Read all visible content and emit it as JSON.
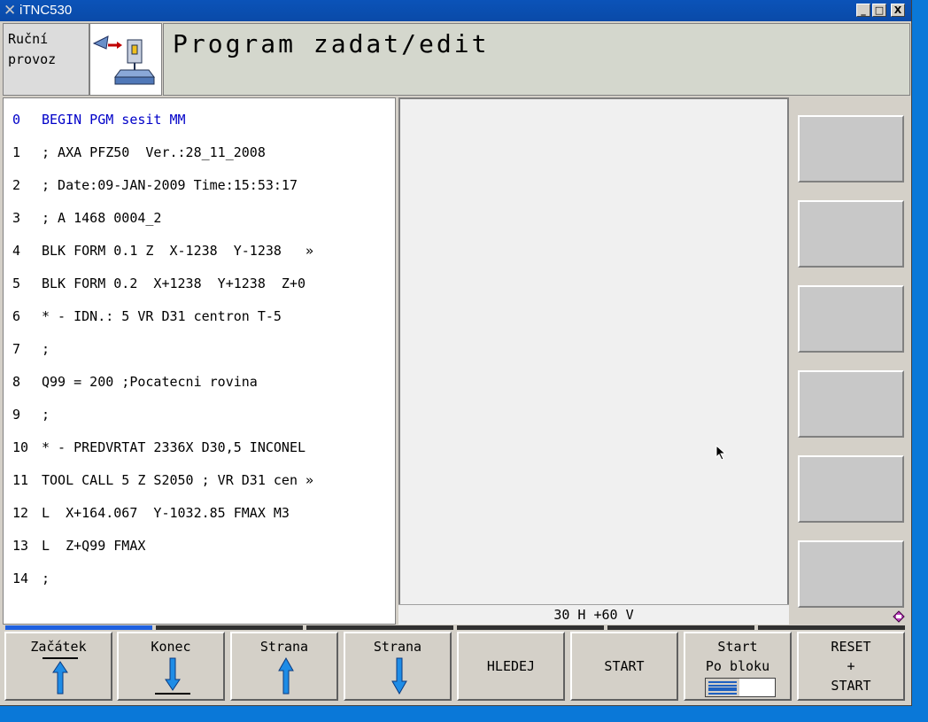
{
  "window": {
    "title": "iTNC530",
    "minimize": "_",
    "maximize": "□",
    "close": "X"
  },
  "mode": {
    "line1": "Ruční",
    "line2": "provoz"
  },
  "header": {
    "title": "Program zadat/edit"
  },
  "program": {
    "lines": [
      {
        "num": "0",
        "text": "BEGIN PGM sesit MM"
      },
      {
        "num": "1",
        "text": "; AXA PFZ50  Ver.:28_11_2008"
      },
      {
        "num": "2",
        "text": "; Date:09-JAN-2009 Time:15:53:17"
      },
      {
        "num": "3",
        "text": "; A 1468 0004_2"
      },
      {
        "num": "4",
        "text": "BLK FORM 0.1 Z  X-1238  Y-1238   »"
      },
      {
        "num": "5",
        "text": "BLK FORM 0.2  X+1238  Y+1238  Z+0"
      },
      {
        "num": "6",
        "text": "* - IDN.: 5 VR D31 centron T-5"
      },
      {
        "num": "7",
        "text": ";"
      },
      {
        "num": "8",
        "text": "Q99 = 200 ;Pocatecni rovina"
      },
      {
        "num": "9",
        "text": ";"
      },
      {
        "num": "10",
        "text": "* - PREDVRTAT 2336X D30,5 INCONEL"
      },
      {
        "num": "11",
        "text": "TOOL CALL 5 Z S2050 ; VR D31 cen »"
      },
      {
        "num": "12",
        "text": "L  X+164.067  Y-1032.85 FMAX M3"
      },
      {
        "num": "13",
        "text": "L  Z+Q99 FMAX"
      },
      {
        "num": "14",
        "text": ";"
      }
    ]
  },
  "graphics": {
    "status": "30 H +60 V"
  },
  "softkeys": {
    "k1": "Začátek",
    "k2": "Konec",
    "k3": "Strana",
    "k4": "Strana",
    "k5": "HLEDEJ",
    "k6": "START",
    "k7a": "Start",
    "k7b": "Po bloku",
    "k8a": "RESET",
    "k8b": "+",
    "k8c": "START"
  },
  "colors": {
    "title_bar": "#0b53b8",
    "program_first_line": "#0000c8",
    "arrow": "#1e8ce6",
    "desktop": "#0a78d8"
  }
}
